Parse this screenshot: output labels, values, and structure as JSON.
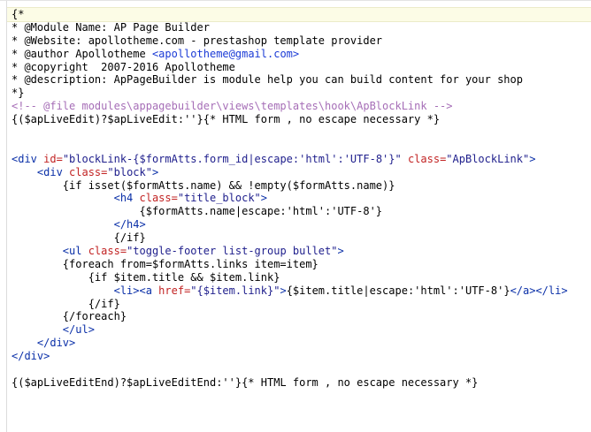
{
  "editor": {
    "lines": [
      [
        {
          "t": "{*",
          "s": "c"
        }
      ],
      [
        {
          "t": "* @Module Name: AP Page Builder",
          "s": "c"
        }
      ],
      [
        {
          "t": "* @Website: apollotheme.com - prestashop template provider",
          "s": "c"
        }
      ],
      [
        {
          "t": "* @author Apollotheme ",
          "s": "c"
        },
        {
          "t": "<apollotheme@gmail.com>",
          "s": "em"
        }
      ],
      [
        {
          "t": "* @copyright  2007-2016 Apollotheme",
          "s": "c"
        }
      ],
      [
        {
          "t": "* @description: ApPageBuilder is module help you can build content for your shop",
          "s": "c"
        }
      ],
      [
        {
          "t": "*}",
          "s": "c"
        }
      ],
      [
        {
          "t": "<!-- @file modules\\appagebuilder\\views\\templates\\hook\\ApBlockLink -->",
          "s": "cm"
        }
      ],
      [
        {
          "t": "{($apLiveEdit)?$apLiveEdit:''}{* HTML form , no escape necessary *}",
          "s": "c"
        }
      ],
      [
        {
          "t": "",
          "s": "c"
        }
      ],
      [
        {
          "t": "",
          "s": "c"
        }
      ],
      [
        {
          "t": "<div ",
          "s": "tg"
        },
        {
          "t": "id=",
          "s": "at"
        },
        {
          "t": "\"blockLink-{$formAtts.form_id|escape:'html':'UTF-8'}\"",
          "s": "sv"
        },
        {
          "t": " class=",
          "s": "at"
        },
        {
          "t": "\"ApBlockLink\"",
          "s": "sv"
        },
        {
          "t": ">",
          "s": "tg"
        }
      ],
      [
        {
          "t": "    <div ",
          "s": "tg"
        },
        {
          "t": "class=",
          "s": "at"
        },
        {
          "t": "\"block\"",
          "s": "sv"
        },
        {
          "t": ">",
          "s": "tg"
        }
      ],
      [
        {
          "t": "        {if isset($formAtts.name) && !empty($formAtts.name)}",
          "s": "c"
        }
      ],
      [
        {
          "t": "                <h4 ",
          "s": "tg"
        },
        {
          "t": "class=",
          "s": "at"
        },
        {
          "t": "\"title_block\"",
          "s": "sv"
        },
        {
          "t": ">",
          "s": "tg"
        }
      ],
      [
        {
          "t": "                    {$formAtts.name|escape:'html':'UTF-8'}",
          "s": "c"
        }
      ],
      [
        {
          "t": "                </h4>",
          "s": "tg"
        }
      ],
      [
        {
          "t": "                {/if}",
          "s": "c"
        }
      ],
      [
        {
          "t": "        <ul ",
          "s": "tg"
        },
        {
          "t": "class=",
          "s": "at"
        },
        {
          "t": "\"toggle-footer list-group bullet\"",
          "s": "sv"
        },
        {
          "t": ">",
          "s": "tg"
        }
      ],
      [
        {
          "t": "        {foreach from=$formAtts.links item=item}",
          "s": "c"
        }
      ],
      [
        {
          "t": "            {if $item.title && $item.link}",
          "s": "c"
        }
      ],
      [
        {
          "t": "                <li><a ",
          "s": "tg"
        },
        {
          "t": "href=",
          "s": "at"
        },
        {
          "t": "\"{$item.link}\"",
          "s": "sv"
        },
        {
          "t": ">",
          "s": "tg"
        },
        {
          "t": "{$item.title|escape:'html':'UTF-8'}",
          "s": "c"
        },
        {
          "t": "</a></li>",
          "s": "tg"
        }
      ],
      [
        {
          "t": "            {/if}",
          "s": "c"
        }
      ],
      [
        {
          "t": "        {/foreach}",
          "s": "c"
        }
      ],
      [
        {
          "t": "        </ul>",
          "s": "tg"
        }
      ],
      [
        {
          "t": "    </div>",
          "s": "tg"
        }
      ],
      [
        {
          "t": "</div>",
          "s": "tg"
        }
      ],
      [
        {
          "t": "",
          "s": "c"
        }
      ],
      [
        {
          "t": "{($apLiveEditEnd)?$apLiveEditEnd:''}{* HTML form , no escape necessary *}",
          "s": "c"
        }
      ]
    ]
  }
}
